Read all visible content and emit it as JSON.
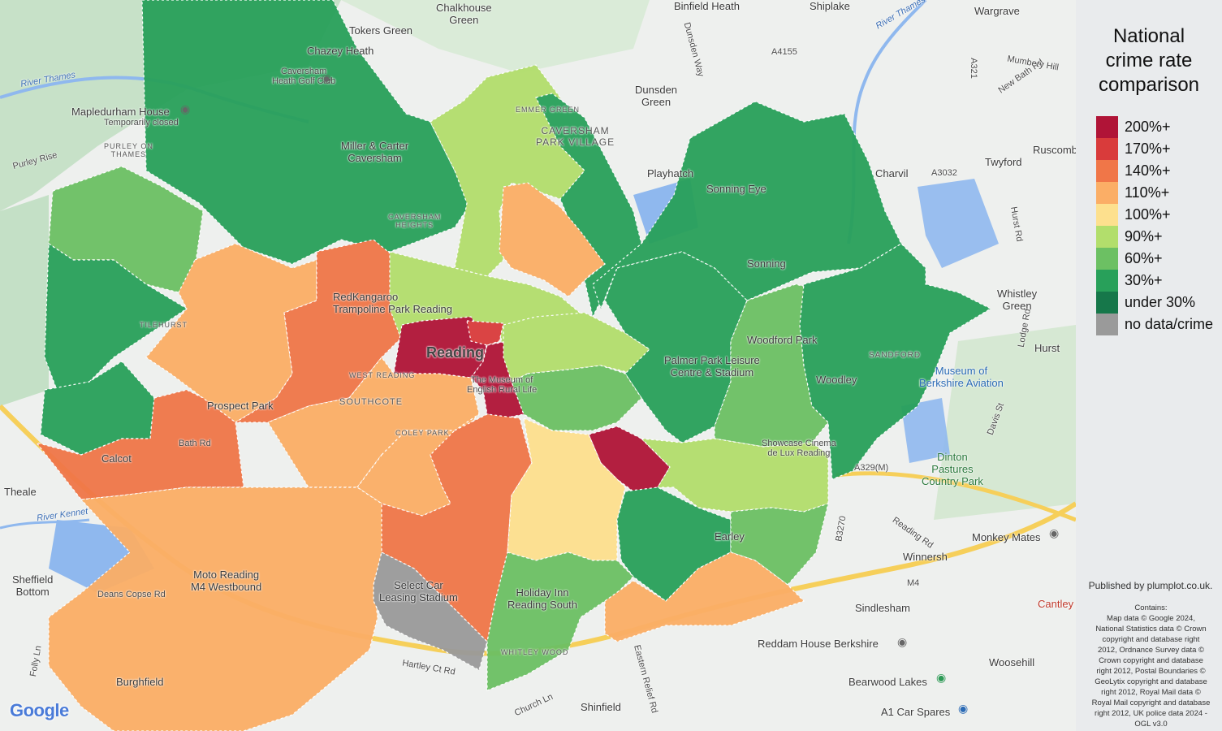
{
  "legend": {
    "title_lines": [
      "National",
      "crime rate",
      "comparison"
    ],
    "items": [
      {
        "label": "200%+",
        "color": "#b01437"
      },
      {
        "label": "170%+",
        "color": "#d93b3b"
      },
      {
        "label": "140%+",
        "color": "#f07648"
      },
      {
        "label": "110%+",
        "color": "#fbae66"
      },
      {
        "label": "100%+",
        "color": "#fde08e"
      },
      {
        "label": "90%+",
        "color": "#b2de6c"
      },
      {
        "label": "60%+",
        "color": "#6cc063"
      },
      {
        "label": "30%+",
        "color": "#28a05a"
      },
      {
        "label": "under 30%",
        "color": "#16774a"
      },
      {
        "label": "no data/crime",
        "color": "#9a9a9a"
      }
    ]
  },
  "published": "Published by plumplot.co.uk.",
  "contains": "Contains:\nMap data © Google 2024,\nNational Statistics data © Crown\ncopyright and database right\n2012, Ordnance Survey data ©\nCrown copyright and database\nright 2012, Postal Boundaries ©\nGeoLytix copyright and database\nright 2012, Royal Mail data ©\nRoyal Mail copyright and database\nright 2012, UK police data 2024 -\nOGL v3.0",
  "map": {
    "provider_logo": "Google",
    "places": {
      "chalkhouse_green": "Chalkhouse\nGreen",
      "tokers_green": "Tokers Green",
      "chazey_heath": "Chazey Heath",
      "caversham_heath_golf": "Caversham\nHeath Golf Club",
      "binfield_heath": "Binfield Heath",
      "shiplake": "Shiplake",
      "wargrave": "Wargrave",
      "river_thames_1": "River Thames",
      "river_thames_2": "River Thames",
      "mapledurham_house": "Mapledurham House",
      "temporarily_closed": "Temporarily closed",
      "purley_on_thames": "PURLEY ON\nTHAMES",
      "miller_carter": "Miller & Carter\nCaversham",
      "emmer_green": "EMMER GREEN",
      "caversham_park_village": "CAVERSHAM\nPARK VILLAGE",
      "dunsden_green": "Dunsden\nGreen",
      "playhatch": "Playhatch",
      "sonning_eye": "Sonning Eye",
      "charvil": "Charvil",
      "twyford": "Twyford",
      "ruscombe": "Ruscomb",
      "caversham_heights": "CAVERSHAM\nHEIGHTS",
      "sonning": "Sonning",
      "whistley_green": "Whistley\nGreen",
      "redkangaroo": "RedKangaroo\nTrampoline Park Reading",
      "reading": "Reading",
      "tilehurst": "TILEHURST",
      "west_reading": "WEST READING",
      "prospect_park": "Prospect Park",
      "southcote": "SOUTHCOTE",
      "coley_park": "COLEY PARK",
      "museum_english_rural": "The Museum of\nEnglish Rural Life",
      "palmer_park": "Palmer Park Leisure\nCentre & Stadium",
      "woodford_park": "Woodford Park",
      "woodley": "Woodley",
      "sandford": "SANDFORD",
      "hurst": "Hurst",
      "museum_aviation": "Museum of\nBerkshire Aviation",
      "showcase_cinema": "Showcase Cinema\nde Lux Reading",
      "dinton_pastures": "Dinton\nPastures\nCountry Park",
      "calcot": "Calcot",
      "theale": "Theale",
      "river_kennet": "River Kennet",
      "earley": "Earley",
      "winnersh": "Winnersh",
      "monkey_mates": "Monkey Mates",
      "moto_reading": "Moto Reading\nM4 Westbound",
      "sheffield_bottom": "Sheffield\nBottom",
      "select_car": "Select Car\nLeasing Stadium",
      "holiday_inn": "Holiday Inn\nReading South",
      "sindlesham": "Sindlesham",
      "cantley": "Cantley",
      "whitley_wood": "WHITLEY WOOD",
      "reddam_house": "Reddam House Berkshire",
      "woosehill": "Woosehill",
      "burghfield": "Burghfield",
      "bearwood_lakes": "Bearwood Lakes",
      "shinfield": "Shinfield",
      "a1_car_spares": "A1 Car Spares",
      "m4": "M4",
      "a329m": "A329(M)",
      "a4155": "A4155",
      "reading_rd": "Reading Rd",
      "hartley_ct_rd": "Hartley Ct Rd",
      "church_ln": "Church Ln",
      "deans_copse_rd": "Deans Copse Rd",
      "lodge_rd": "Lodge Rd",
      "hurst_rd": "Hurst Rd",
      "new_bath_rd": "New Bath Rd",
      "mumbery_hill": "Mumbery Hill",
      "davis_st": "Davis St",
      "bath_rd": "Bath Rd",
      "a3032": "A3032",
      "a321": "A321",
      "b3270": "B3270",
      "dunsden_way": "Dunsden Way",
      "folly_ln": "Folly Ln",
      "purley_rise": "Purley Rise",
      "eastern_relief_rd": "Eastern Relief Rd"
    }
  }
}
